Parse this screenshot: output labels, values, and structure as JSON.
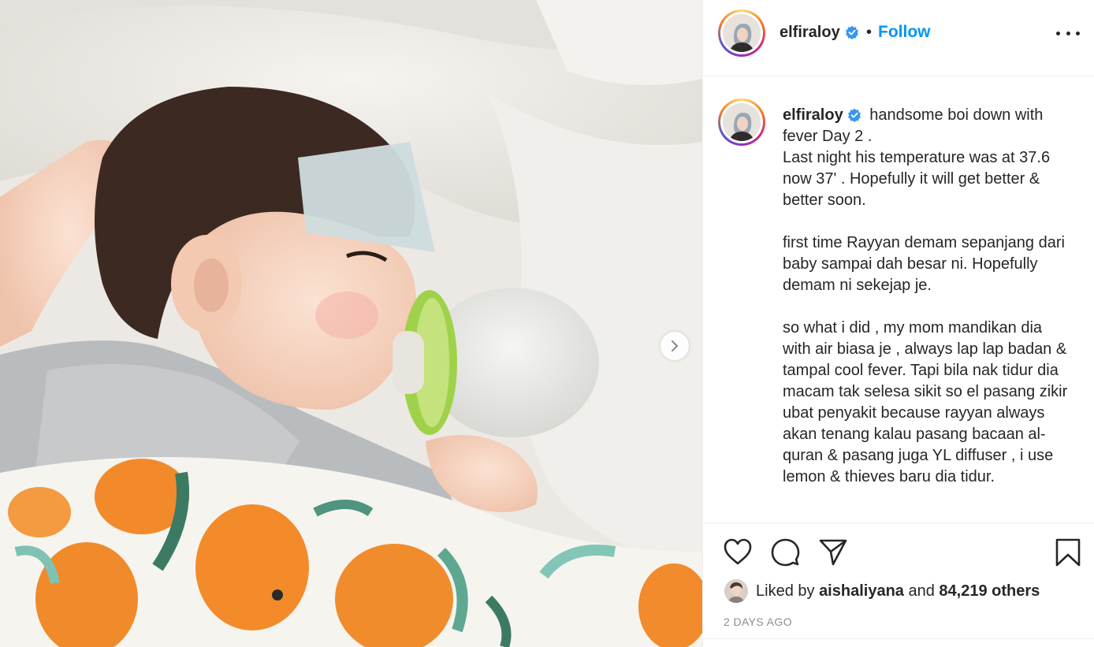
{
  "post": {
    "username": "elfiraloy",
    "follow_label": "Follow",
    "separator": "•",
    "caption_text": " handsome boi down with fever Day 2 .\nLast night his temperature was at 37.6 now 37' . Hopefully it will get better & better soon.\n\nfirst time Rayyan demam sepanjang dari baby sampai dah besar ni. Hopefully demam ni sekejap je.\n\nso what i did , my mom mandikan dia with air biasa je , always lap lap badan & tampal cool fever. Tapi bila nak tidur dia macam tak selesa sikit so el pasang zikir ubat penyakit because rayyan always akan tenang kalau pasang bacaan al-quran & pasang juga YL diffuser , i use lemon & thieves baru dia tidur.",
    "likes": {
      "prefix": "Liked by",
      "liker": "aishaliyana",
      "connector": "and",
      "others": "84,219 others"
    },
    "time_ago": "2 DAYS AGO"
  },
  "colors": {
    "accent": "#0095f6",
    "verified": "#3897f0",
    "text": "#262626",
    "muted": "#8e8e8e"
  },
  "icons": [
    "verified-badge-icon",
    "more-options-icon",
    "heart-icon",
    "comment-icon",
    "share-icon",
    "bookmark-icon",
    "chevron-right-icon"
  ]
}
